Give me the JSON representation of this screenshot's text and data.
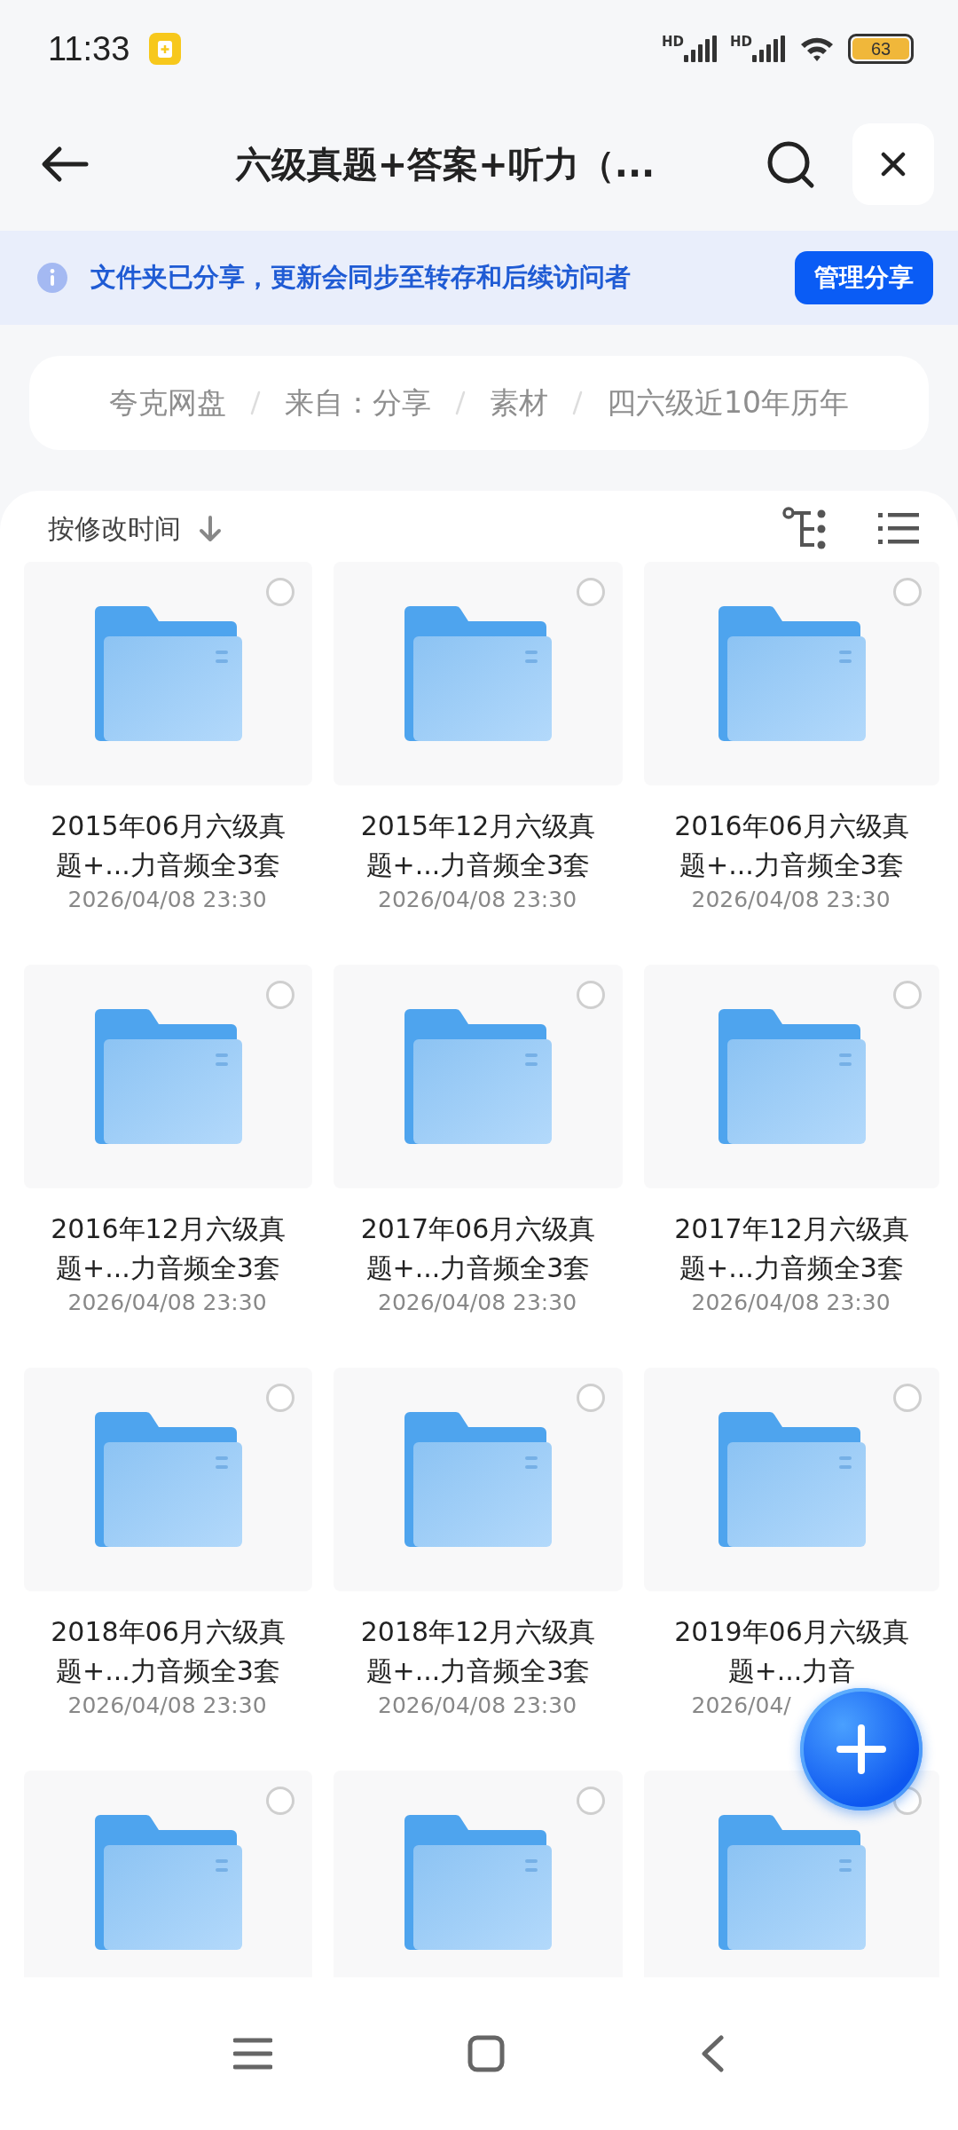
{
  "status_bar": {
    "time": "11:33",
    "signals": [
      {
        "label": "HD"
      },
      {
        "label": "HD"
      }
    ],
    "battery": "63"
  },
  "header": {
    "title": "六级真题+答案+听力（..."
  },
  "share_banner": {
    "message": "文件夹已分享，更新会同步至转存和后续访问者",
    "button": "管理分享"
  },
  "breadcrumb": [
    {
      "label": "夸克网盘"
    },
    {
      "label": "来自：分享"
    },
    {
      "label": "素材"
    },
    {
      "label": "四六级近10年历年"
    }
  ],
  "sort": {
    "label": "按修改时间"
  },
  "files": [
    {
      "name": "2015年06月六级真题+...力音频全3套",
      "date": "2026/04/08 23:30",
      "selected": false
    },
    {
      "name": "2015年12月六级真题+...力音频全3套",
      "date": "2026/04/08 23:30",
      "selected": false
    },
    {
      "name": "2016年06月六级真题+...力音频全3套",
      "date": "2026/04/08 23:30",
      "selected": false
    },
    {
      "name": "2016年12月六级真题+...力音频全3套",
      "date": "2026/04/08 23:30",
      "selected": false
    },
    {
      "name": "2017年06月六级真题+...力音频全3套",
      "date": "2026/04/08 23:30",
      "selected": false
    },
    {
      "name": "2017年12月六级真题+...力音频全3套",
      "date": "2026/04/08 23:30",
      "selected": false
    },
    {
      "name": "2018年06月六级真题+...力音频全3套",
      "date": "2026/04/08 23:30",
      "selected": false
    },
    {
      "name": "2018年12月六级真题+...力音频全3套",
      "date": "2026/04/08 23:30",
      "selected": false
    },
    {
      "name": "2019年06月六级真题+...力音",
      "date": "2026/04/",
      "selected": false
    },
    {
      "selected": false
    },
    {
      "selected": false
    },
    {
      "selected": false
    }
  ]
}
